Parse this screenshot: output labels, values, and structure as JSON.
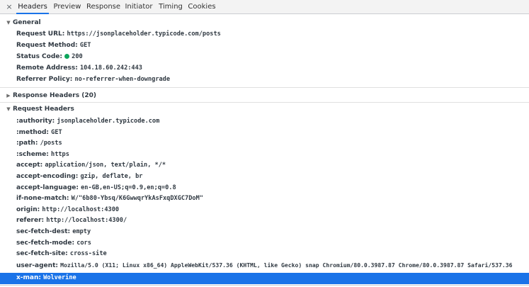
{
  "tabs": [
    {
      "label": "Headers"
    },
    {
      "label": "Preview"
    },
    {
      "label": "Response"
    },
    {
      "label": "Initiator"
    },
    {
      "label": "Timing"
    },
    {
      "label": "Cookies"
    }
  ],
  "close_symbol": "×",
  "general": {
    "title": "General",
    "rows": [
      {
        "key": "Request URL:",
        "value": "https://jsonplaceholder.typicode.com/posts"
      },
      {
        "key": "Request Method:",
        "value": "GET"
      },
      {
        "key": "Status Code:",
        "value": "200"
      },
      {
        "key": "Remote Address:",
        "value": "104.18.60.242:443"
      },
      {
        "key": "Referrer Policy:",
        "value": "no-referrer-when-downgrade"
      }
    ]
  },
  "response_headers": {
    "title": "Response Headers (20)"
  },
  "request_headers": {
    "title": "Request Headers",
    "rows": [
      {
        "key": ":authority:",
        "value": "jsonplaceholder.typicode.com"
      },
      {
        "key": ":method:",
        "value": "GET"
      },
      {
        "key": ":path:",
        "value": "/posts"
      },
      {
        "key": ":scheme:",
        "value": "https"
      },
      {
        "key": "accept:",
        "value": "application/json, text/plain, */*"
      },
      {
        "key": "accept-encoding:",
        "value": "gzip, deflate, br"
      },
      {
        "key": "accept-language:",
        "value": "en-GB,en-US;q=0.9,en;q=0.8"
      },
      {
        "key": "if-none-match:",
        "value": "W/\"6b80-Ybsq/K6GwwqrYkAsFxqDXGC7DoM\""
      },
      {
        "key": "origin:",
        "value": "http://localhost:4300"
      },
      {
        "key": "referer:",
        "value": "http://localhost:4300/"
      },
      {
        "key": "sec-fetch-dest:",
        "value": "empty"
      },
      {
        "key": "sec-fetch-mode:",
        "value": "cors"
      },
      {
        "key": "sec-fetch-site:",
        "value": "cross-site"
      },
      {
        "key": "user-agent:",
        "value": "Mozilla/5.0 (X11; Linux x86_64) AppleWebKit/537.36 (KHTML, like Gecko) snap Chromium/80.0.3987.87 Chrome/80.0.3987.87 Safari/537.36"
      },
      {
        "key": "x-man:",
        "value": "Wolverine"
      }
    ]
  },
  "colors": {
    "accent": "#1a73e8",
    "status_ok": "#0ea55c"
  },
  "icons": {
    "close": "close-icon",
    "expanded": "triangle-down-icon",
    "collapsed": "triangle-right-icon"
  }
}
